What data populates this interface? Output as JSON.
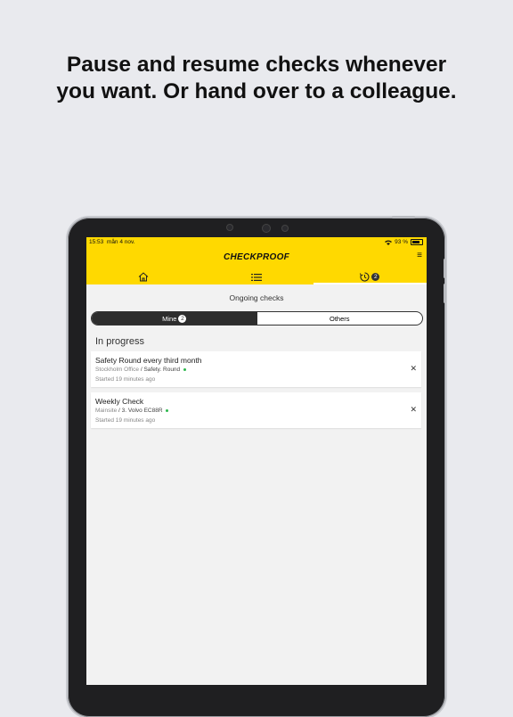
{
  "headline": {
    "line1": "Pause and resume checks whenever",
    "line2": "you want. Or hand over to a colleague."
  },
  "status_bar": {
    "time": "15:53",
    "date": "mån 4 nov.",
    "battery": "93 %"
  },
  "app": {
    "logo": "CHECKPROOF"
  },
  "tabs": [
    {
      "icon": "home-icon"
    },
    {
      "icon": "list-icon"
    },
    {
      "icon": "ongoing-checks-icon",
      "badge": "2"
    }
  ],
  "page": {
    "title": "Ongoing checks"
  },
  "segment": {
    "mine_label": "Mine",
    "mine_count": "2",
    "others_label": "Others"
  },
  "section": {
    "title": "In progress"
  },
  "checks": [
    {
      "title": "Safety Round every third month",
      "location": "Stockholm Office",
      "object": "Safety. Round",
      "started": "Started 19 minutes ago"
    },
    {
      "title": "Weekly Check",
      "location": "Mainsite",
      "object": "3. Volvo EC88R",
      "started": "Started 19 minutes ago"
    }
  ],
  "colors": {
    "brand_yellow": "#ffd900",
    "active_segment": "#2d2d2d",
    "status_green": "#2db84d"
  }
}
